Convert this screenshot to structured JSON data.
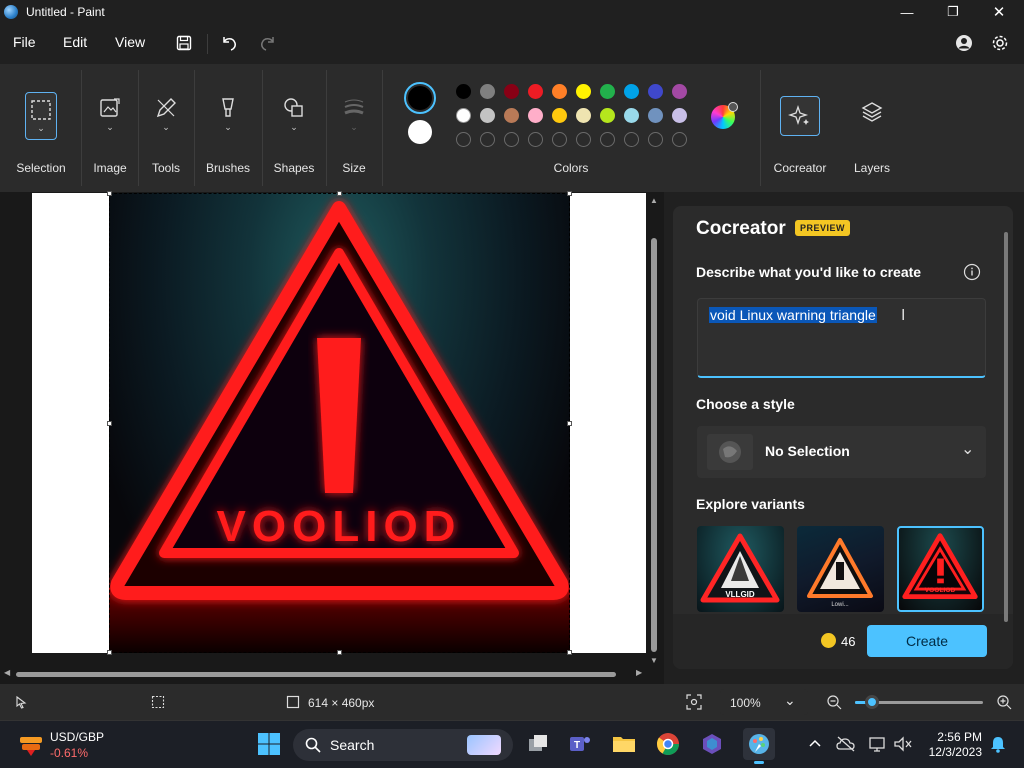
{
  "window": {
    "title": "Untitled - Paint",
    "controls": {
      "minimize": "—",
      "maximize": "❐",
      "close": "✕"
    }
  },
  "menu": {
    "items": [
      "File",
      "Edit",
      "View"
    ]
  },
  "ribbon": {
    "groups": {
      "selection": "Selection",
      "image": "Image",
      "tools": "Tools",
      "brushes": "Brushes",
      "shapes": "Shapes",
      "size": "Size",
      "colors": "Colors",
      "cocreator": "Cocreator",
      "layers": "Layers"
    },
    "palette_row1": [
      "#000000",
      "#7f7f7f",
      "#880015",
      "#ed1c24",
      "#ff7f27",
      "#fff200",
      "#22b14c",
      "#00a2e8",
      "#3f48cc",
      "#a349a4"
    ],
    "palette_row2": [
      "#ffffff",
      "#c3c3c3",
      "#b97a57",
      "#ffaec9",
      "#ffc90e",
      "#efe4b0",
      "#b5e61d",
      "#99d9ea",
      "#7092be",
      "#c8bfe7"
    ],
    "primary_color": "#000000",
    "secondary_color": "#ffffff"
  },
  "canvas": {
    "image_text": "VOOLIOD"
  },
  "cocreator": {
    "title": "Cocreator",
    "badge": "PREVIEW",
    "describe_label": "Describe what you'd like to create",
    "prompt_value": "void Linux warning triangle",
    "style_label": "Choose a style",
    "style_value": "No Selection",
    "variants_label": "Explore variants",
    "variants": [
      {
        "caption": "VLLGID"
      },
      {
        "caption": "Lowi..."
      },
      {
        "caption": "VOOLIOD"
      }
    ],
    "credits": "46",
    "create_label": "Create"
  },
  "status": {
    "dimensions": "614 × 460px",
    "zoom": "100%",
    "zoom_level": 0.13
  },
  "taskbar": {
    "ticker_symbol": "USD/GBP",
    "ticker_change": "-0.61%",
    "search_label": "Search",
    "time": "2:56 PM",
    "date": "12/3/2023"
  }
}
